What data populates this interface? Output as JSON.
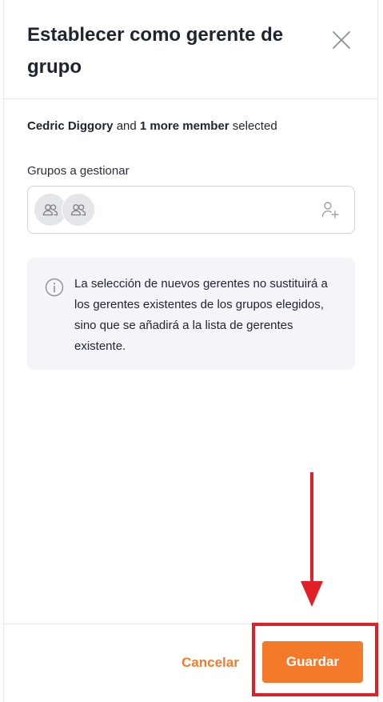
{
  "dialog": {
    "title": "Establecer como gerente de grupo",
    "close_icon": "close-icon"
  },
  "selection": {
    "primary_name": "Cedric Diggory",
    "connector": " and ",
    "more_count": "1 more member",
    "suffix": " selected"
  },
  "groups_field": {
    "label": "Grupos a gestionar",
    "avatars": [
      "group-avatar-icon",
      "group-avatar-icon"
    ],
    "add_icon": "add-user-icon"
  },
  "info": {
    "icon": "info-icon",
    "text": "La selección de nuevos gerentes no sustituirá a los gerentes existentes de los grupos elegidos, sino que se añadirá a la lista de gerentes existente."
  },
  "footer": {
    "cancel_label": "Cancelar",
    "save_label": "Guardar"
  },
  "colors": {
    "accent": "#f5792a",
    "annotation": "#e01f26",
    "info_background": "#f3f5f9"
  }
}
